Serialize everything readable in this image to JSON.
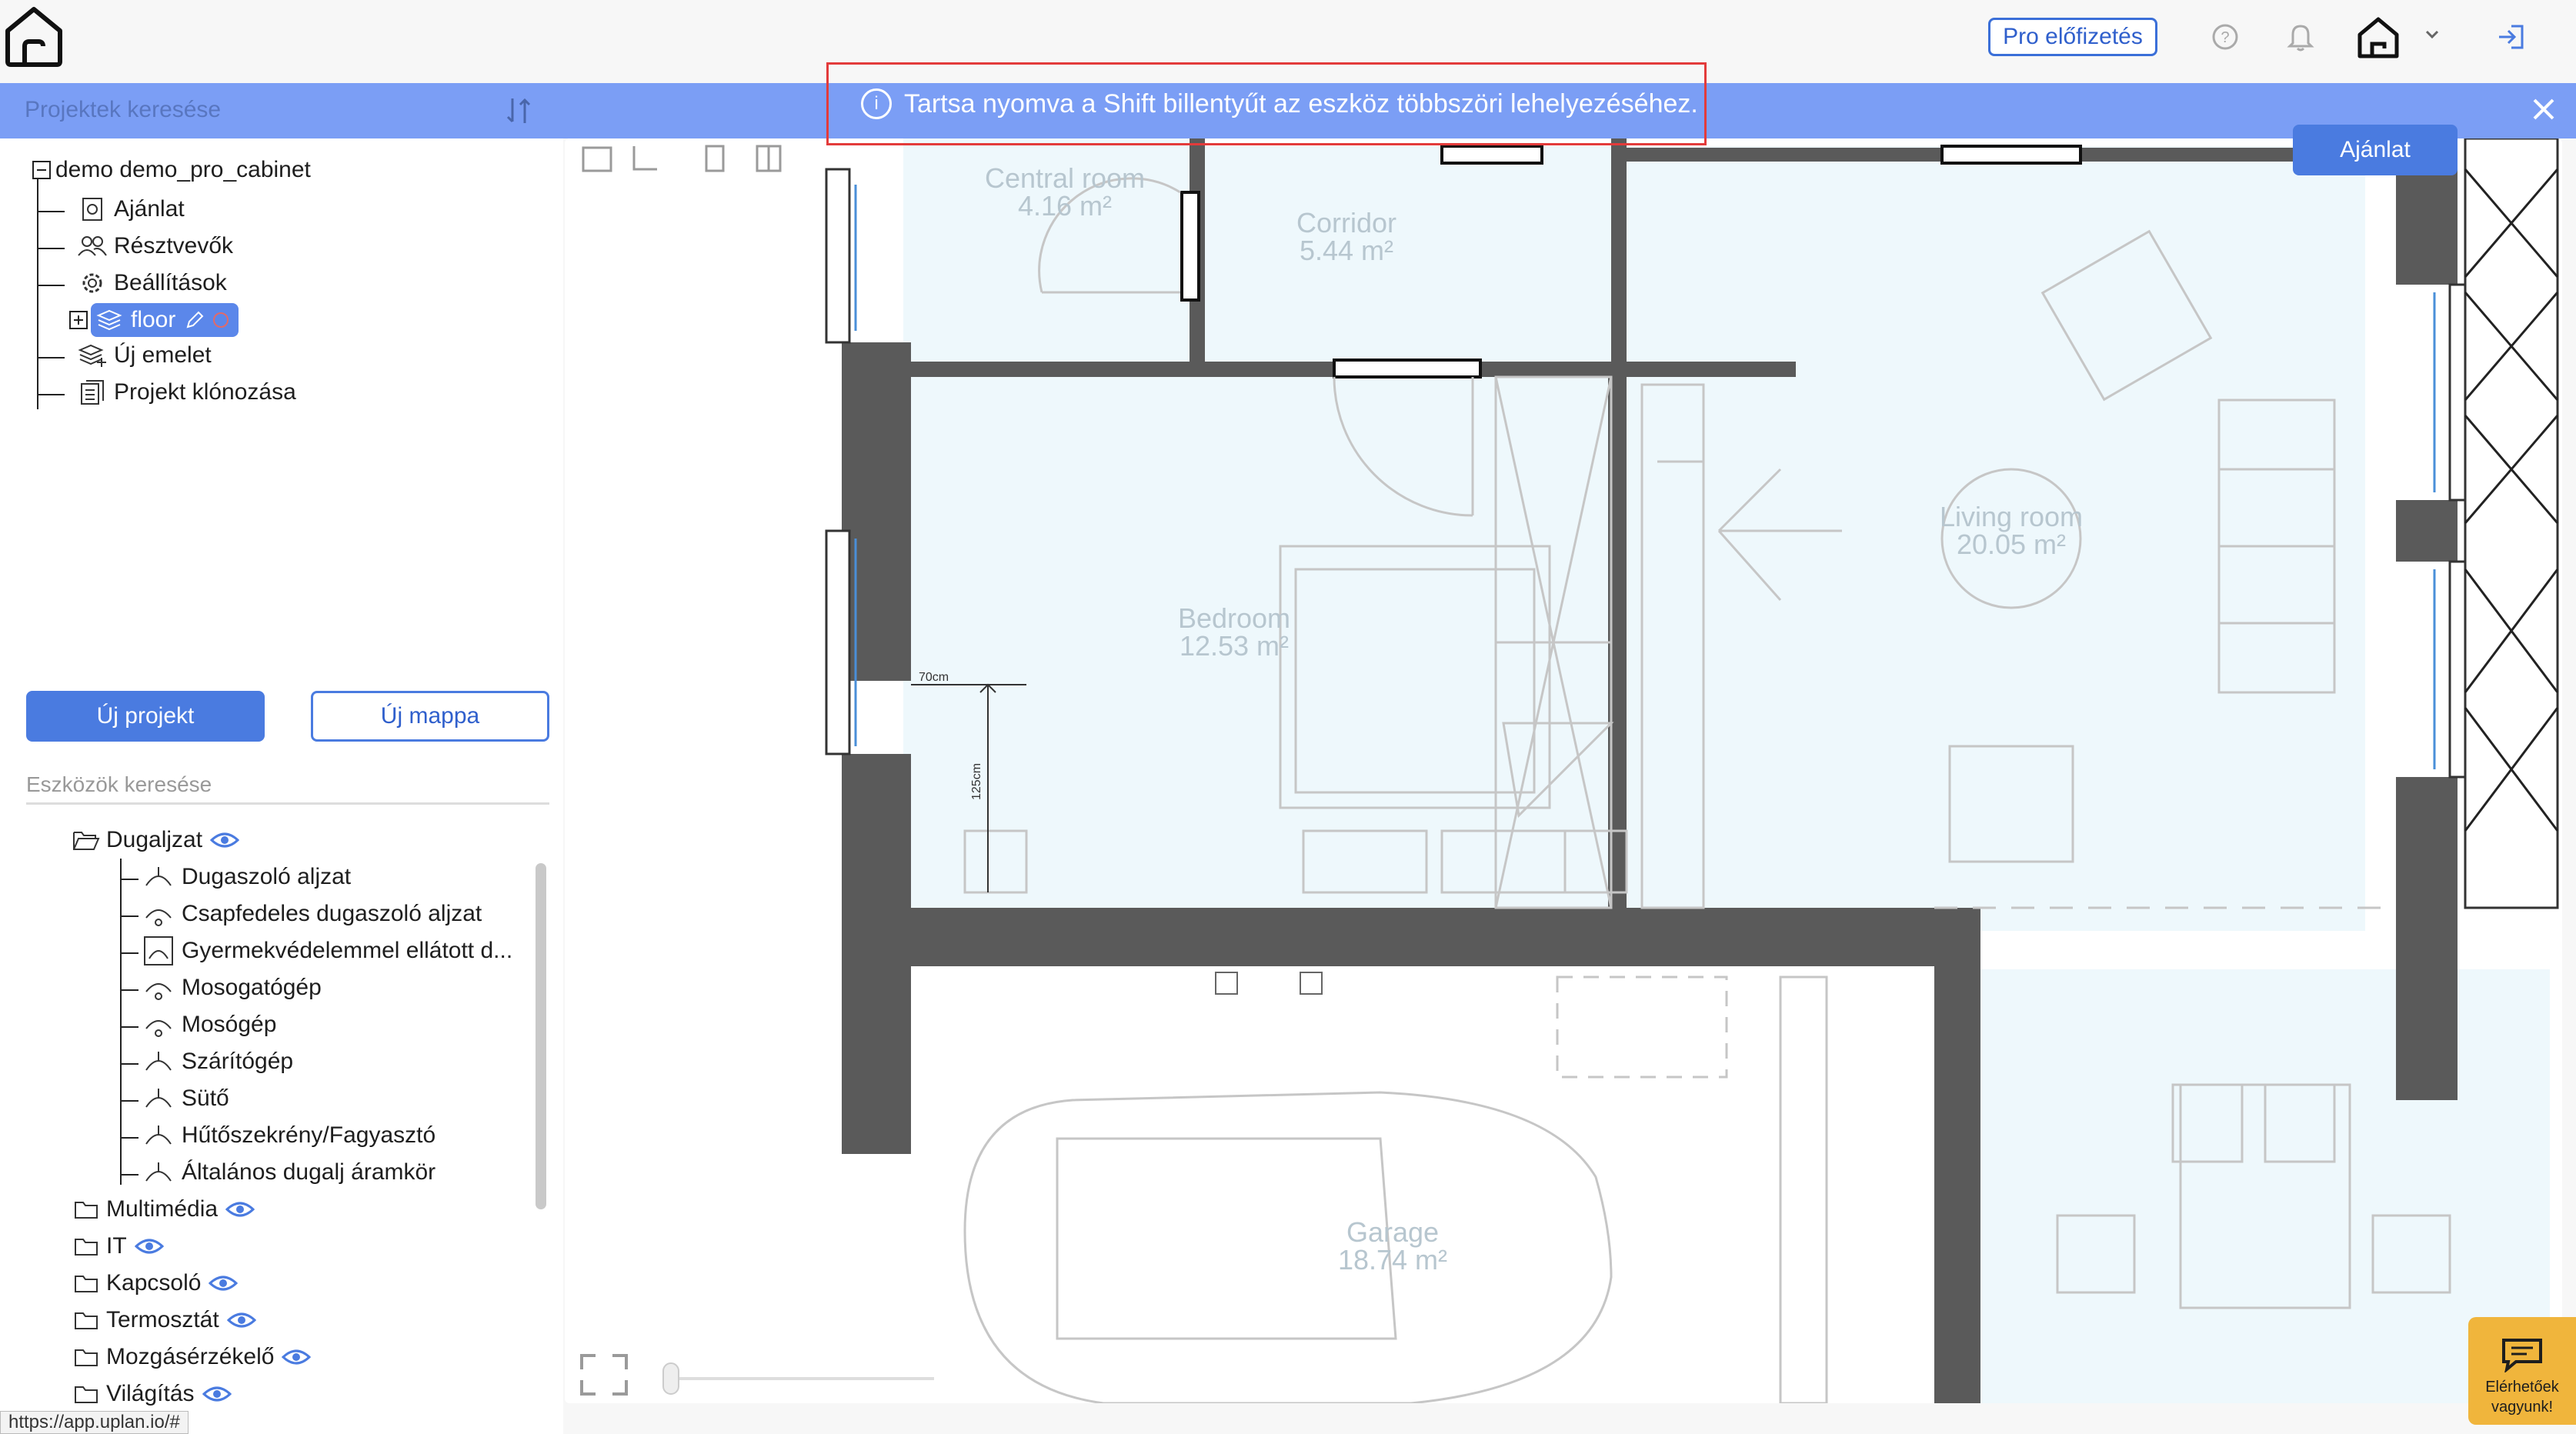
{
  "topbar": {
    "pro_label": "Pro előfizetés"
  },
  "projects": {
    "search_placeholder": "Projektek keresése",
    "tree": {
      "root": "demo demo_pro_cabinet",
      "children": [
        "Ajánlat",
        "Résztvevők",
        "Beállítások",
        "floor",
        "Új emelet",
        "Projekt klónozása"
      ]
    },
    "new_project": "Új projekt",
    "new_folder": "Új mappa"
  },
  "notification": {
    "text": "Tartsa nyomva a Shift billentyűt az eszköz többszöri lehelyezéséhez."
  },
  "tools": {
    "search_placeholder": "Eszközök keresése",
    "open_category": "Dugaljzat",
    "items": [
      "Dugaszoló aljzat",
      "Csapfedeles dugaszoló aljzat",
      "Gyermekvédelemmel ellátott d...",
      "Mosogatógép",
      "Mosógép",
      "Szárítógép",
      "Sütő",
      "Hűtőszekrény/Fagyasztó",
      "Általános dugalj áramkör"
    ],
    "categories": [
      "Multimédia",
      "IT",
      "Kapcsoló",
      "Termosztát",
      "Mozgásérzékelő",
      "Világítás"
    ]
  },
  "canvas": {
    "offer_button": "Ajánlat",
    "rooms": [
      {
        "name": "Central room",
        "area": "4.16 m²"
      },
      {
        "name": "Corridor",
        "area": "5.44 m²"
      },
      {
        "name": "Bedroom",
        "area": "12.53 m²"
      },
      {
        "name": "Living room",
        "area": "20.05 m²"
      },
      {
        "name": "Garage",
        "area": "18.74 m²"
      }
    ],
    "dim_width": "70cm",
    "dim_height": "125cm"
  },
  "chat": {
    "line1": "Elérhetőek",
    "line2": "vagyunk!"
  },
  "status_url": "https://app.uplan.io/#",
  "colors": {
    "accent": "#4a7be0",
    "notification_bar": "#7b9ef5",
    "highlight_border": "#e33b3b",
    "room_fill": "#eef8fc",
    "wall": "#5a5a5a",
    "chat_bg": "#f0b53c"
  }
}
